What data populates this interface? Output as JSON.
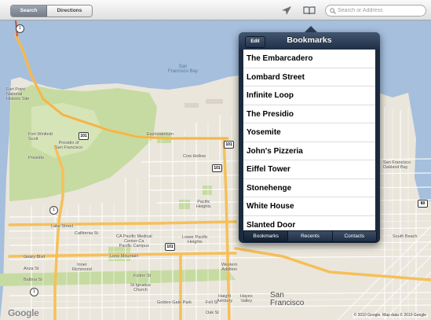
{
  "toolbar": {
    "search_tab": "Search",
    "directions_tab": "Directions",
    "search_placeholder": "Search or Address",
    "location_icon": "location-arrow-icon",
    "bookmarks_icon": "open-book-icon"
  },
  "bookmarks": {
    "edit_label": "Edit",
    "title": "Bookmarks",
    "items": [
      "The Embarcadero",
      "Lombard Street",
      "Infinite Loop",
      "The Presidio",
      "Yosemite",
      "John's Pizzeria",
      "Eiffel Tower",
      "Stonehenge",
      "White House",
      "Slanted Door"
    ],
    "tabs": [
      "Bookmarks",
      "Recents",
      "Contacts"
    ]
  },
  "map": {
    "labels": {
      "sf_bay": "San\nFrancisco Bay",
      "presidio": "Presidio of\nSan Francisco",
      "fort_winfield": "Fort Winfield\nScott",
      "presidio_small": "Presidio",
      "cow_hollow": "Cow Hollow",
      "exploratorium": "Exploratorium",
      "lake_street": "Lake Street",
      "california_st": "California St",
      "geary_blvd": "Geary Blvd",
      "lone_mountain": "Lone Mountain",
      "anza_st": "Anza St",
      "balboa_st": "Balboa St",
      "fulton_st": "Fulton St",
      "inner_richmond": "Inner\nRichmond",
      "lower_pacific": "Lower Pacific\nHeights",
      "pacific_heights": "Pacific\nHeights",
      "western_addition": "Western\nAddition",
      "ca_pacific_med": "CA Pacific Medical\nCenter-Ca\nPacific Campus",
      "golden_gate_park": "Golden Gate Park",
      "haight": "Haight\nAshbury",
      "hayes_valley": "Hayes\nValley",
      "south_beach": "South Beach",
      "st_ignatius": "St Ignatius\nChurch",
      "san_francisco": "San\nFrancisco",
      "oak_st": "Oak St",
      "fell_st": "Fell St",
      "fort_point": "Fort Point\nNational\nHistoric Site",
      "bay_bridge": "San Francisco\nOakland Bay"
    },
    "shields": [
      "101",
      "101",
      "101",
      "101",
      "1",
      "1",
      "1",
      "80"
    ],
    "google": "Google",
    "attribution": "© 2010 Google. Map data © 2010 Google"
  },
  "colors": {
    "water": "#a5bfdd",
    "park": "#c6dba1",
    "land": "#eae6dc",
    "highway": "#f5c05a",
    "popover_dark": "#1b2a3d"
  }
}
